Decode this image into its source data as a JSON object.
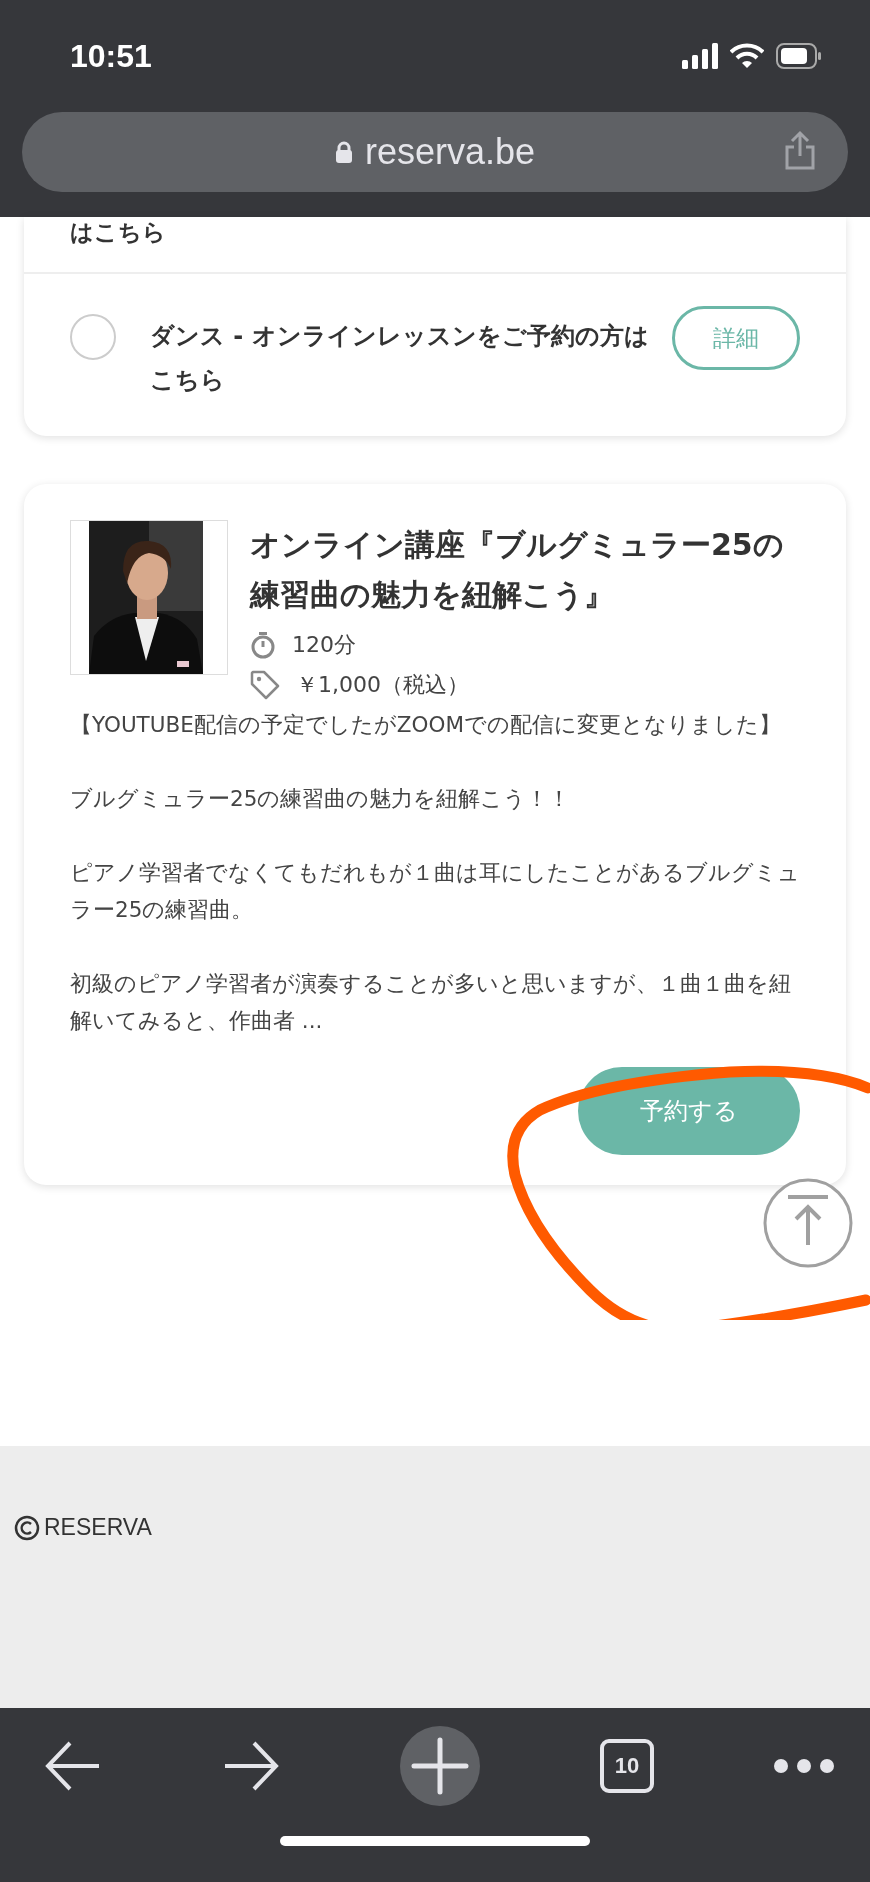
{
  "status_bar": {
    "time": "10:51"
  },
  "address_bar": {
    "url": "reserva.be"
  },
  "plan_card": {
    "cut_off_text": "はこちら",
    "option": {
      "label": "ダンス - オンラインレッスンをご予約の方はこちら",
      "selected": false,
      "button": "詳細"
    }
  },
  "event_card": {
    "title": "オンライン講座『ブルグミュラー25の練習曲の魅力を紐解こう』",
    "duration": "120分",
    "price": "￥1,000（税込）",
    "paragraphs": [
      "【YOUTUBE配信の予定でしたがZOOMでの配信に変更となりました】",
      "ブルグミュラー25の練習曲の魅力を紐解こう！！",
      "ピアノ学習者でなくてもだれもが１曲は耳にしたことがあるブルグミュラー25の練習曲。",
      "初級のピアノ学習者が演奏することが多いと思いますが、１曲１曲を紐解いてみると、作曲者 ..."
    ],
    "button": "予約する"
  },
  "footer": {
    "copyright": "RESERVA"
  },
  "toolbar": {
    "tab_count": "10"
  }
}
